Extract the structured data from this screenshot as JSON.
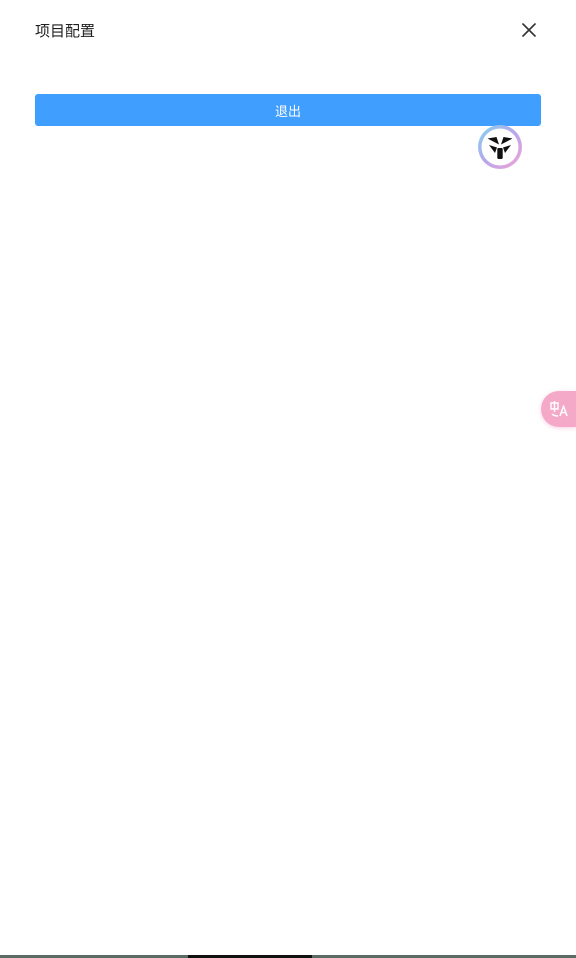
{
  "dialog": {
    "title": "项目配置",
    "exit_label": "退出"
  },
  "icons": {
    "close": "close-icon",
    "assistant": "assistant-logo-icon",
    "translate": "translate-icon"
  },
  "colors": {
    "primary": "#409eff",
    "translate_tab": "#f5a9c9"
  }
}
